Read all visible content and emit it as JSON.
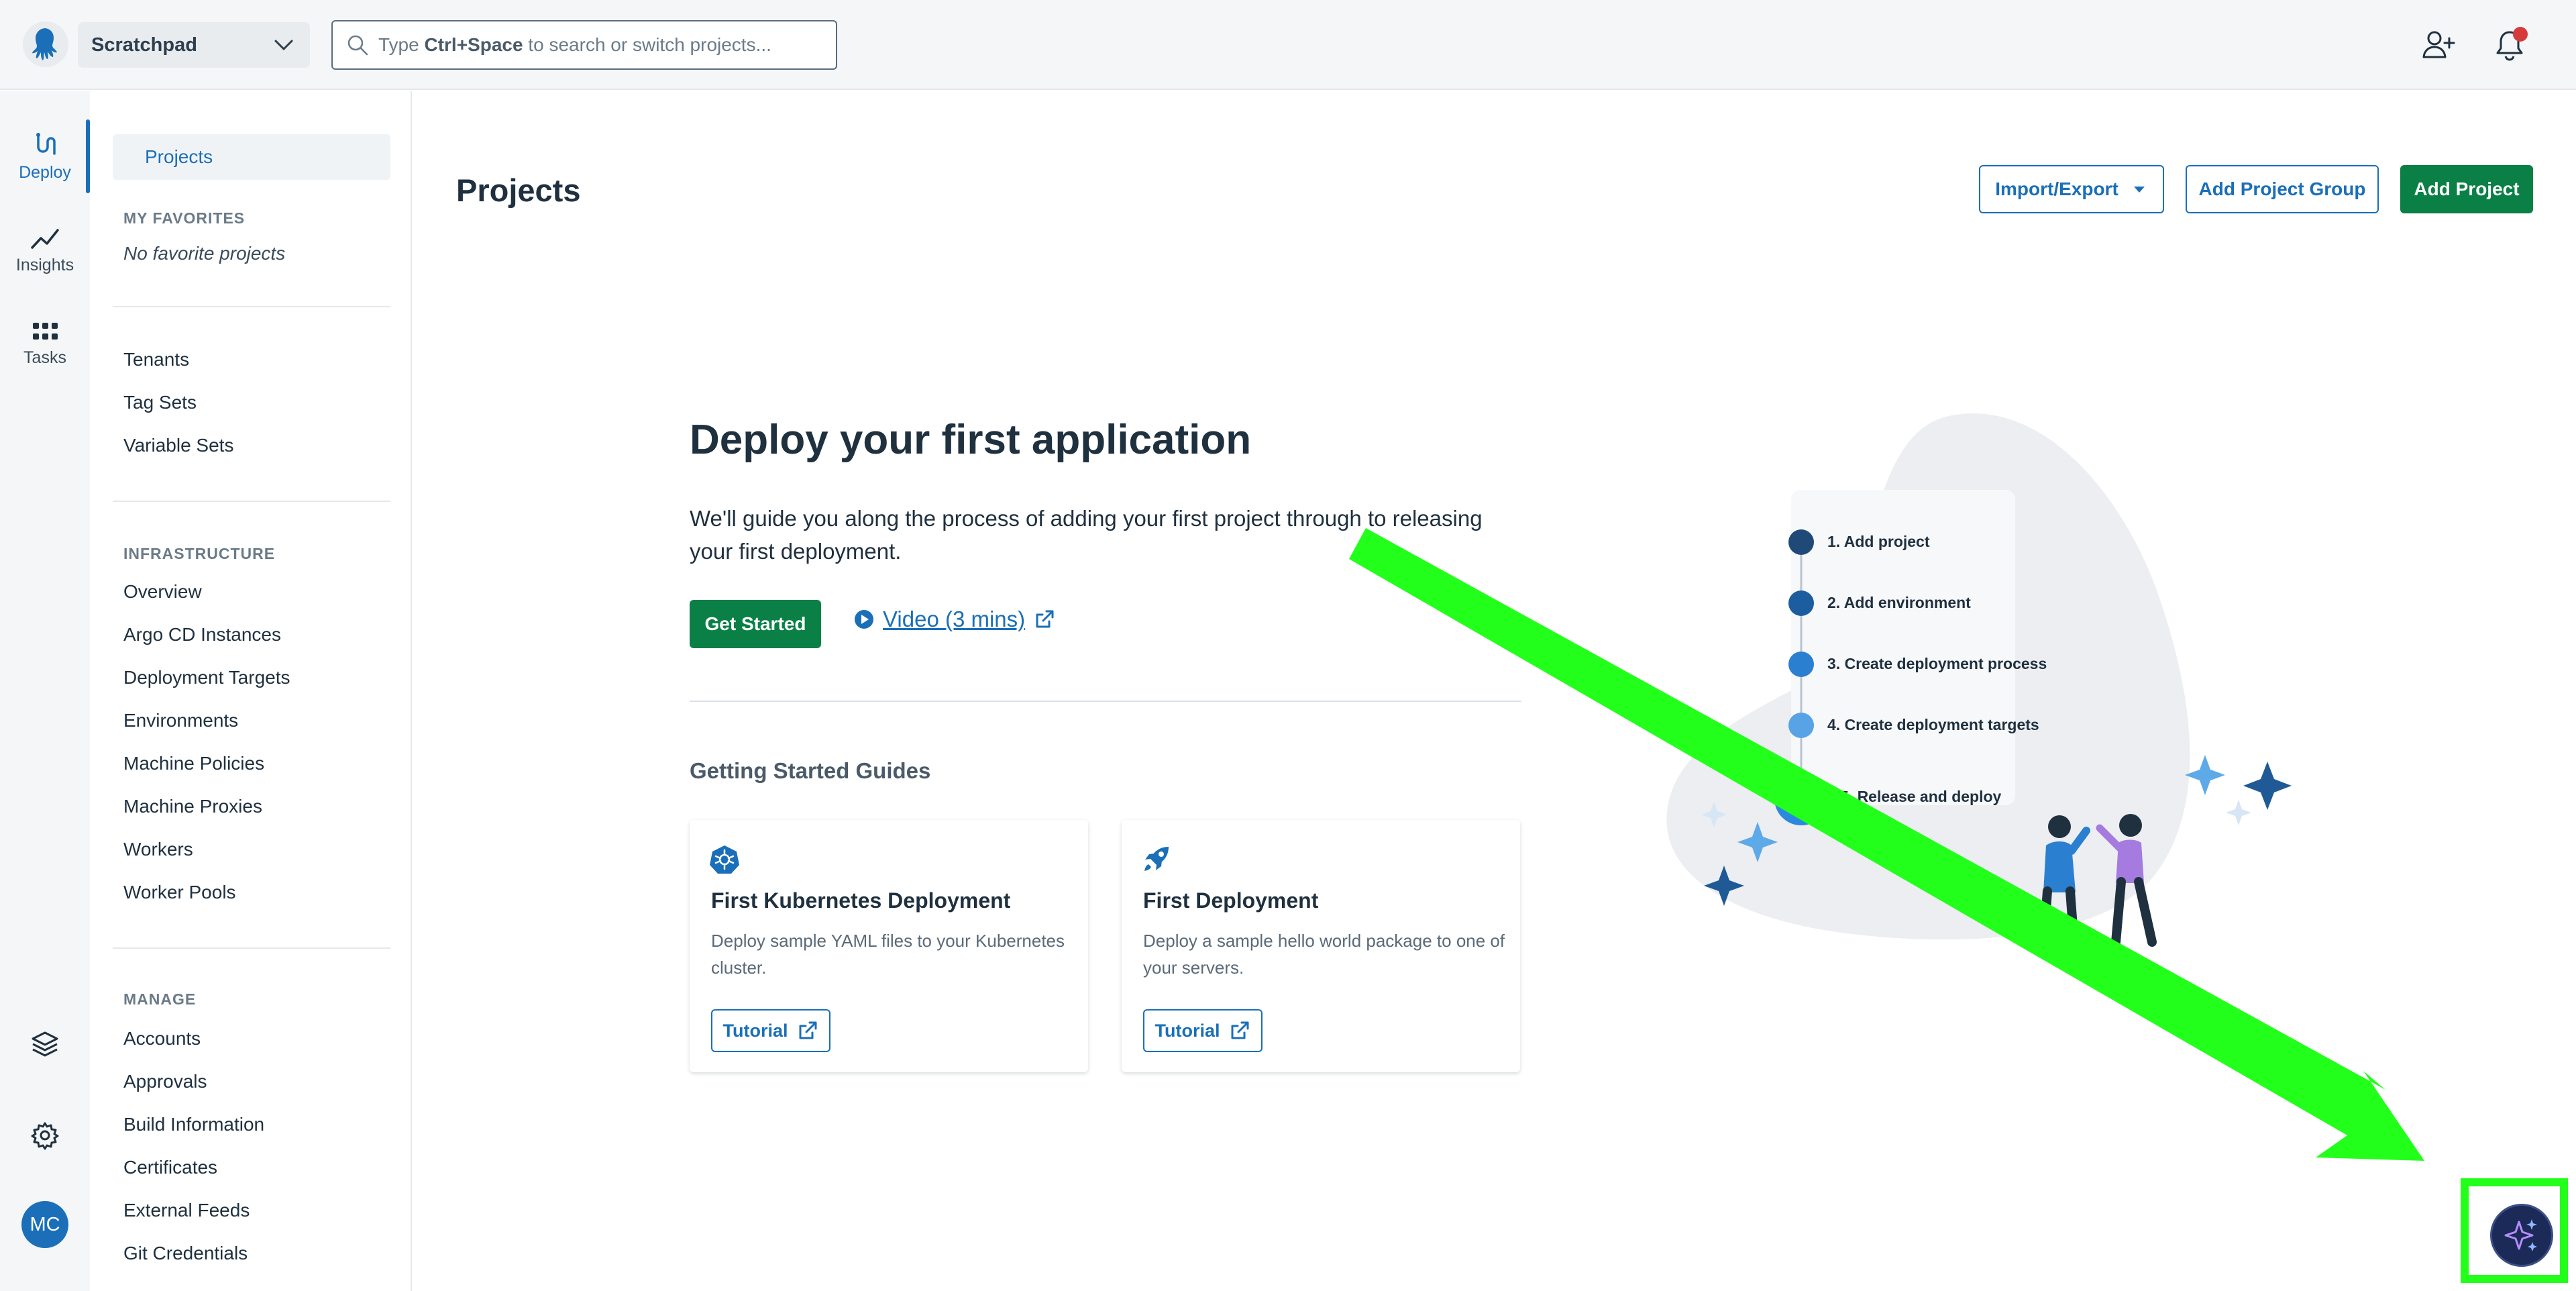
{
  "topbar": {
    "space_name": "Scratchpad",
    "search_placeholder_pre": "Type ",
    "search_placeholder_key": "Ctrl+Space",
    "search_placeholder_post": " to search or switch projects..."
  },
  "rail": {
    "items": [
      {
        "label": "Deploy",
        "icon": "deploy-icon"
      },
      {
        "label": "Insights",
        "icon": "insights-icon"
      },
      {
        "label": "Tasks",
        "icon": "tasks-icon"
      }
    ],
    "avatar_initials": "MC"
  },
  "sidenav": {
    "active": "Projects",
    "favorites_head": "MY FAVORITES",
    "favorites_empty": "No favorite projects",
    "group1": [
      "Tenants",
      "Tag Sets",
      "Variable Sets"
    ],
    "infra_head": "INFRASTRUCTURE",
    "infra": [
      "Overview",
      "Argo CD Instances",
      "Deployment Targets",
      "Environments",
      "Machine Policies",
      "Machine Proxies",
      "Workers",
      "Worker Pools"
    ],
    "manage_head": "MANAGE",
    "manage": [
      "Accounts",
      "Approvals",
      "Build Information",
      "Certificates",
      "External Feeds",
      "Git Credentials"
    ]
  },
  "main": {
    "title": "Projects",
    "import_export": "Import/Export",
    "add_group": "Add Project Group",
    "add_project": "Add Project",
    "hero_title": "Deploy your first application",
    "hero_desc": "We'll guide you along the process of adding your first project through to releasing your first deployment.",
    "get_started": "Get Started",
    "video": "Video (3 mins)",
    "guides_head": "Getting Started Guides",
    "cards": [
      {
        "title": "First Kubernetes Deployment",
        "desc": "Deploy sample YAML files to your Kubernetes cluster.",
        "button": "Tutorial",
        "icon": "kubernetes-icon"
      },
      {
        "title": "First Deployment",
        "desc": "Deploy a sample hello world package to one of your servers.",
        "button": "Tutorial",
        "icon": "rocket-icon"
      }
    ],
    "steps": [
      "1. Add project",
      "2. Add environment",
      "3. Create deployment process",
      "4. Create deployment targets",
      "5. Release and deploy"
    ]
  },
  "colors": {
    "accent": "#1a6fb8",
    "primary_green": "#0b8046",
    "annotation_green": "#22ff1a"
  }
}
